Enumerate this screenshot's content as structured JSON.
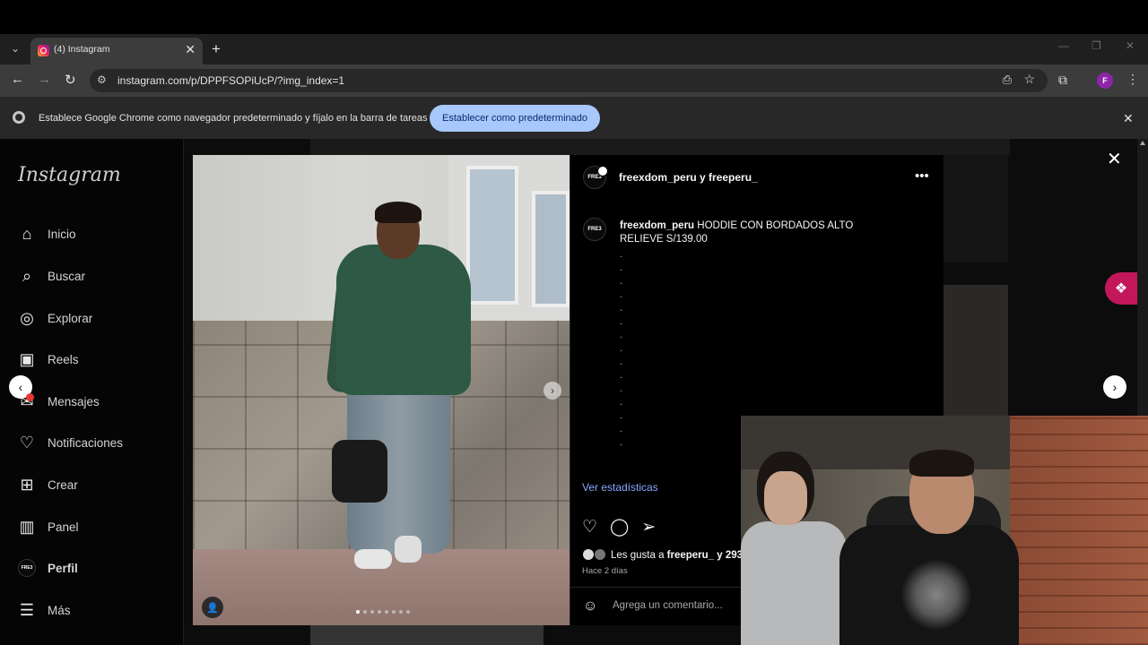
{
  "browser": {
    "tab": {
      "title": "(4) Instagram",
      "close": "✕"
    },
    "new_tab": "+",
    "url": "instagram.com/p/DPPFSOPiUcP/?img_index=1",
    "profile_initial": "F",
    "infobar": {
      "message": "Establece Google Chrome como navegador predeterminado y fíjalo en la barra de tareas",
      "button": "Establecer como predeterminado"
    }
  },
  "instagram": {
    "logo": "Instagram",
    "nav": [
      {
        "label": "Inicio",
        "icon": "home-icon"
      },
      {
        "label": "Buscar",
        "icon": "search-icon"
      },
      {
        "label": "Explorar",
        "icon": "compass-icon"
      },
      {
        "label": "Reels",
        "icon": "reels-icon"
      },
      {
        "label": "Mensajes",
        "icon": "messenger-icon"
      },
      {
        "label": "Notificaciones",
        "icon": "heart-icon"
      },
      {
        "label": "Crear",
        "icon": "plus-square-icon"
      },
      {
        "label": "Panel",
        "icon": "dashboard-icon"
      },
      {
        "label": "Perfil",
        "icon": "profile-avatar"
      },
      {
        "label": "Más",
        "icon": "menu-icon"
      }
    ],
    "post": {
      "header_users": "freexdom_peru y freeperu_",
      "avatar_text": "FRE3",
      "caption_user": "freexdom_peru",
      "caption_text": "HODDIE CON BORDADOS ALTO RELIEVE S/139.00",
      "caption_dots": ".\n.\n.\n.\n.\n.\n.\n.\n.\n.\n.\n.\n.\n.\n.",
      "stats_link": "Ver estadísticas",
      "likes_prefix": "Les gusta a ",
      "likes_user": "freeperu_",
      "likes_suffix": " y 293",
      "time_ago": "Hace 2 días",
      "comment_placeholder": "Agrega un comentario...",
      "carousel_count": 8,
      "carousel_active": 1
    }
  },
  "colors": {
    "chrome_dark": "#1f1f1f",
    "infobar_button": "#a8c7fa",
    "link_blue": "#8aa6ff",
    "pink_accent": "#c2185b"
  }
}
